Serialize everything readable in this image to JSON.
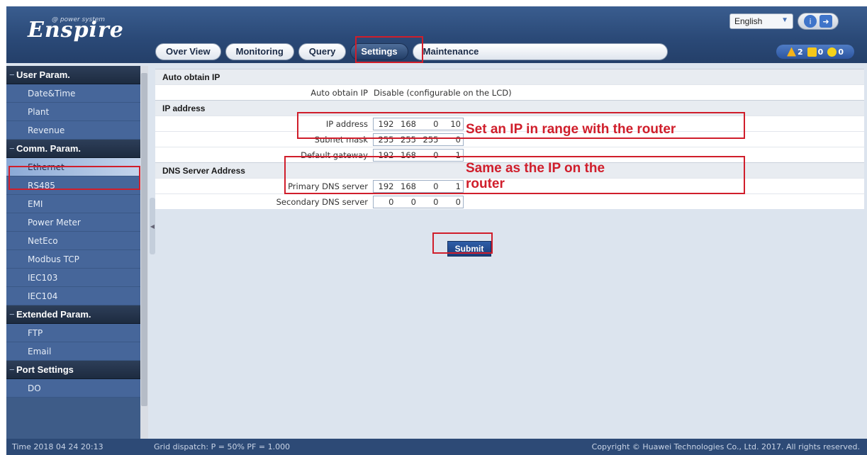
{
  "header": {
    "logo": "Enspire",
    "logo_sub": "@ power system",
    "language": "English",
    "tabs": [
      "Over View",
      "Monitoring",
      "Query",
      "Settings",
      "Maintenance"
    ],
    "active_tab": "Settings",
    "alarms": {
      "major": "2",
      "minor": "0",
      "warning": "0"
    }
  },
  "sidebar": {
    "groups": [
      {
        "label": "User Param.",
        "items": [
          "Date&Time",
          "Plant",
          "Revenue"
        ]
      },
      {
        "label": "Comm. Param.",
        "items": [
          "Ethernet",
          "RS485",
          "EMI",
          "Power Meter",
          "NetEco",
          "Modbus TCP",
          "IEC103",
          "IEC104"
        ]
      },
      {
        "label": "Extended Param.",
        "items": [
          "FTP",
          "Email"
        ]
      },
      {
        "label": "Port Settings",
        "items": [
          "DO"
        ]
      }
    ],
    "active_item": "Ethernet"
  },
  "content": {
    "auto_section": "Auto obtain IP",
    "auto_label": "Auto obtain IP",
    "auto_value": "Disable (configurable on the LCD)",
    "ip_section": "IP address",
    "ip_label": "IP address",
    "ip_value": [
      "192",
      "168",
      "0",
      "10"
    ],
    "mask_label": "Subnet mask",
    "mask_value": [
      "255",
      "255",
      "255",
      "0"
    ],
    "gateway_label": "Default gateway",
    "gateway_value": [
      "192",
      "168",
      "0",
      "1"
    ],
    "dns_section": "DNS Server Address",
    "dns1_label": "Primary DNS server",
    "dns1_value": [
      "192",
      "168",
      "0",
      "1"
    ],
    "dns2_label": "Secondary DNS server",
    "dns2_value": [
      "0",
      "0",
      "0",
      "0"
    ],
    "submit": "Submit"
  },
  "annotations": {
    "ip_note": "Set an IP in range with the router",
    "gateway_note_1": "Same as the IP on the",
    "gateway_note_2": "router"
  },
  "footer": {
    "time": "Time  2018 04 24 20:13",
    "grid": "Grid dispatch: P = 50% PF = 1.000",
    "copyright": "Copyright © Huawei Technologies Co., Ltd. 2017. All rights reserved."
  },
  "colors": {
    "accent": "#2b4a78",
    "annotation": "#d01e2b"
  }
}
